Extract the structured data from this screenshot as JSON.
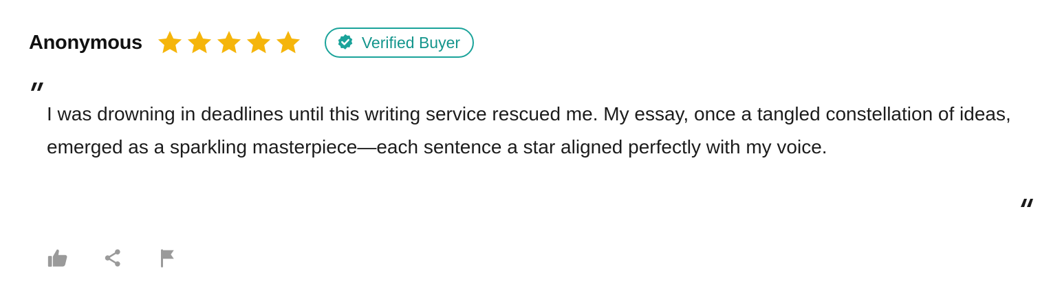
{
  "review": {
    "author": "Anonymous",
    "rating": 5,
    "rating_max": 5,
    "badge": {
      "label": "Verified Buyer",
      "icon": "verified-check-icon",
      "color": "#1aa39a"
    },
    "star_color": "#f5b50b",
    "body": "I was drowning in deadlines until this writing service rescued me. My essay, once a tangled constellation of ideas, emerged as a sparkling masterpiece—each sentence a star aligned perfectly with my voice.",
    "quote_open": "“",
    "quote_close": "”"
  },
  "actions": [
    {
      "name": "like",
      "icon": "thumbs-up-icon"
    },
    {
      "name": "share",
      "icon": "share-icon"
    },
    {
      "name": "report",
      "icon": "flag-icon"
    }
  ],
  "colors": {
    "icon_gray": "#9a9a9a",
    "text": "#1c1c1c"
  }
}
